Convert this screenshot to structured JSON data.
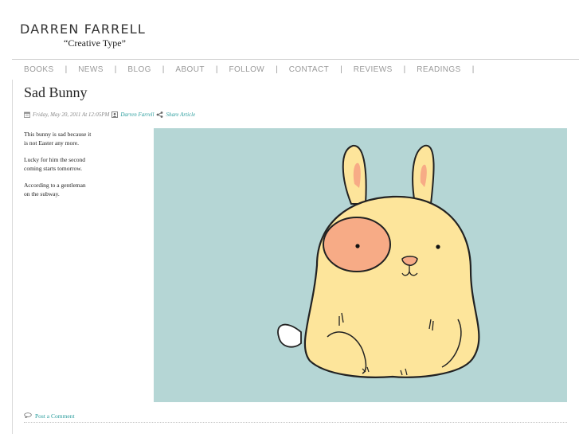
{
  "site": {
    "title": "DARREN FARRELL",
    "tagline": "“Creative Type”"
  },
  "nav": {
    "items": [
      {
        "label": "BOOKS"
      },
      {
        "label": "NEWS"
      },
      {
        "label": "BLOG"
      },
      {
        "label": "ABOUT"
      },
      {
        "label": "FOLLOW"
      },
      {
        "label": "CONTACT"
      },
      {
        "label": "REVIEWS"
      },
      {
        "label": "READINGS"
      }
    ],
    "separator": "|"
  },
  "post": {
    "title": "Sad Bunny",
    "date": "Friday, May 20, 2011 At 12:05PM",
    "author": "Darren Farrell",
    "share_label": "Share Article",
    "paragraphs": [
      "This bunny is sad because it\nis not Easter any more.",
      "Lucky for him the second\ncoming starts tomorrow.",
      "According to a gentleman\non the subway."
    ],
    "comment_label": "Post a Comment"
  },
  "colors": {
    "accent": "#2a9d9d",
    "nav_text": "#9a9a9a",
    "image_background": "#b5d6d5",
    "bunny_body": "#fde59b",
    "bunny_patch": "#f7ab86"
  },
  "icons": {
    "calendar": "calendar-icon",
    "author": "person-icon",
    "share": "share-icon",
    "comment": "speech-bubble-icon"
  }
}
